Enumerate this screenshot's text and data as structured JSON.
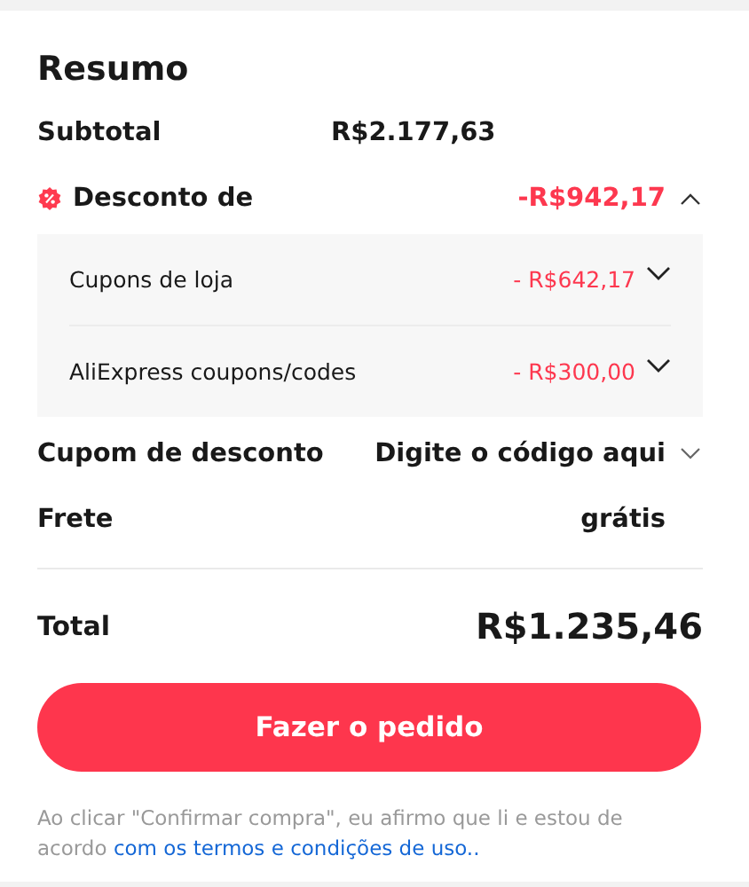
{
  "title": "Resumo",
  "subtotal": {
    "label": "Subtotal",
    "value": "R$2.177,63"
  },
  "discount": {
    "label": "Desconto de",
    "value": "-R$942,17",
    "expanded": true,
    "items": [
      {
        "label": "Cupons de loja",
        "value": "- R$642,17",
        "expanded": false
      },
      {
        "label": "AliExpress coupons/codes",
        "value": "- R$300,00",
        "expanded": false
      }
    ]
  },
  "coupon": {
    "label": "Cupom de desconto",
    "placeholder": "Digite o código aqui",
    "expanded": false
  },
  "shipping": {
    "label": "Frete",
    "value": "grátis"
  },
  "total": {
    "label": "Total",
    "value": "R$1.235,46"
  },
  "button": "Fazer o pedido",
  "terms": {
    "text": "Ao clicar \"Confirmar compra\", eu afirmo que li e estou de acordo ",
    "link": "com os termos e condições de uso.."
  }
}
